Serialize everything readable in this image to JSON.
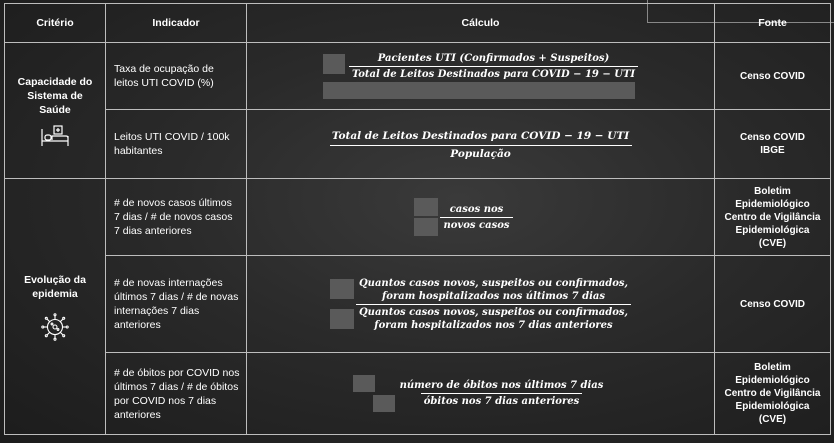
{
  "header": {
    "criterio": "Critério",
    "indicador": "Indicador",
    "calculo": "Cálculo",
    "fonte": "Fonte"
  },
  "groups": [
    {
      "label": "Capacidade do Sistema de Saúde",
      "icon": "hospital-bed-icon"
    },
    {
      "label": "Evolução da epidemia",
      "icon": "virus-icon"
    }
  ],
  "rows": [
    {
      "indicador": "Taxa de ocupação de leitos UTI COVID (%)",
      "numerador": [
        "Pacientes UTI (Confirmados + Suspeitos)"
      ],
      "denominador": [
        "Total de Leitos Destinados para COVID − 19  −  UTI"
      ],
      "fonte": [
        "Censo COVID"
      ]
    },
    {
      "indicador": "Leitos UTI COVID / 100k habitantes",
      "numerador": [
        "Total de Leitos Destinados para COVID − 19  −  UTI"
      ],
      "denominador": [
        "População"
      ],
      "fonte": [
        "Censo COVID",
        "IBGE"
      ]
    },
    {
      "indicador": "# de novos casos últimos 7 dias / # de novos casos 7 dias anteriores",
      "numerador": [
        "casos nos"
      ],
      "denominador": [
        "novos casos"
      ],
      "fonte": [
        "Boletim",
        "Epidemiológico",
        "Centro de Vigilância",
        "Epidemiológica",
        "(CVE)"
      ]
    },
    {
      "indicador": "# de novas internações últimos 7 dias / # de novas internações 7 dias anteriores",
      "numerador": [
        "Quantos casos novos, suspeitos ou confirmados,",
        "foram hospitalizados nos últimos 7 dias"
      ],
      "denominador": [
        "Quantos casos novos, suspeitos ou confirmados,",
        "foram hospitalizados nos 7 dias anteriores"
      ],
      "fonte": [
        "Censo COVID"
      ]
    },
    {
      "indicador": "# de óbitos por COVID nos últimos 7 dias / # de óbitos por COVID nos 7 dias anteriores",
      "numerador": [
        "número de óbitos nos últimos 7 dias"
      ],
      "denominador": [
        "óbitos  nos 7 dias anteriores"
      ],
      "fonte": [
        "Boletim",
        "Epidemiológico",
        "Centro de Vigilância",
        "Epidemiológica",
        "(CVE)"
      ]
    }
  ],
  "colors": {
    "background": "#2a2a2a",
    "border": "#bdbdbd",
    "text": "#ffffff",
    "redaction": "#5a5a5a"
  }
}
